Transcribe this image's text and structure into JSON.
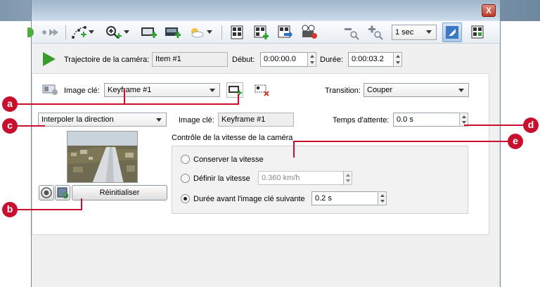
{
  "window": {
    "close_glyph": "X"
  },
  "toolbar": {
    "speed_value": "1 sec"
  },
  "camera_path": {
    "label": "Trajectoire de la caméra:",
    "name_value": "Item #1",
    "start_label": "Début:",
    "start_value": "0:00:00.0",
    "duration_label": "Durée:",
    "duration_value": "0:00:03.2"
  },
  "keyframe_row": {
    "label": "Image clé:",
    "value": "Keyframe #1",
    "transition_label": "Transition:",
    "transition_value": "Couper"
  },
  "direction": {
    "value": "Interpoler la direction"
  },
  "keyframe_info": {
    "label": "Image clé:",
    "value": "Keyframe #1"
  },
  "wait": {
    "label": "Temps d'attente:",
    "value": "0.0 s"
  },
  "speed_control": {
    "title": "Contrôle de la vitesse de la caméra",
    "keep_speed": "Conserver la vitesse",
    "define_speed": "Définir la vitesse",
    "define_speed_value": "0.360 km/h",
    "duration_to_next": "Durée avant l'image clé suivante",
    "duration_to_next_value": "0.2 s",
    "selected": "duration_to_next"
  },
  "reset_button": "Réinitialiser",
  "callouts": {
    "a": "a",
    "b": "b",
    "c": "c",
    "d": "d",
    "e": "e"
  },
  "colors": {
    "callout": "#c8102e",
    "play": "#3a9b2e"
  }
}
